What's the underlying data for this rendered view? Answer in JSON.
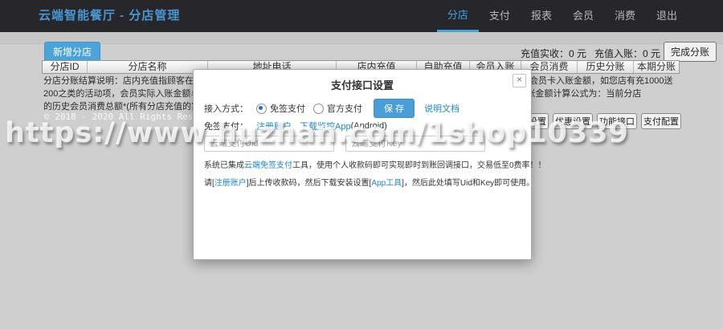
{
  "navbar": {
    "title": "云端智能餐厅 - 分店管理",
    "items": [
      {
        "label": "分店",
        "active": true
      },
      {
        "label": "支付",
        "active": false
      },
      {
        "label": "报表",
        "active": false
      },
      {
        "label": "会员",
        "active": false
      },
      {
        "label": "消费",
        "active": false
      },
      {
        "label": "退出",
        "active": false
      }
    ]
  },
  "toolbar": {
    "add_branch_label": "新增分店",
    "stats": {
      "received_label": "充值实收：",
      "received_value": "0 元",
      "credited_label": "充值入账：",
      "credited_value": "0 元"
    },
    "complete_split_label": "完成分账"
  },
  "table": {
    "headers": [
      "分店ID",
      "分店名称",
      "地址电话",
      "店内充值",
      "自助充值",
      "会员入账",
      "会员消费",
      "历史分账",
      "本期分账"
    ]
  },
  "row_actions": [
    "价格设置",
    "优惠设置",
    "功能接口",
    "支付配置"
  ],
  "info": {
    "line1": "分店分账结算说明：店内充值指顾客在该店内现金或刷卡充值的总金额；自助充值指会员扫码自助充值的总金额；会员入账指会员卡入账金额，如您店有充1000送",
    "line2": "200之类的活动项，会员实际入账金额与充值实收金额并不一致，设置此项的目的是为了在进行分账结算时平衡科目；本期分账金额计算公式为：当前分店",
    "line3": "的历史会员消费总额*(所有分店充值的实际金额/所有分店会员入账总额)"
  },
  "footer": {
    "copyright": "© 2018 - 2020 All Rights Reserved V"
  },
  "modal": {
    "title": "支付接口设置",
    "close_label": "×",
    "access_mode_label": "接入方式：",
    "options": [
      {
        "label": "免签支付",
        "selected": true
      },
      {
        "label": "官方支付",
        "selected": false
      }
    ],
    "save_label": "保 存",
    "docs_link": "说明文档",
    "nosign_label": "免签支付：",
    "register_link": "注册账户",
    "download_link": "下载监控App",
    "download_suffix": "(Android)",
    "uid_placeholder": "云端支付Uid",
    "key_placeholder": "云端支付Key",
    "desc1": {
      "pre": "系统已集成",
      "link": "云端免签支付",
      "post": "工具，使用个人收款码即可实现即时到账回调接口，交易低至0费率！！"
    },
    "desc2": {
      "t1": "请[",
      "link1": "注册账户",
      "t2": "]后上传收款码，然后下载安装设置[",
      "link2": "App工具",
      "t3": "]，然后此处填写Uid和Key即可使用。"
    }
  },
  "watermark": {
    "text": "https://www.huzhan.com/1shop10339"
  },
  "colors": {
    "accent": "#41a2e0",
    "link": "#1f86c7",
    "navbar_bg": "#26262b",
    "button_blue": "#4a9dd6"
  }
}
